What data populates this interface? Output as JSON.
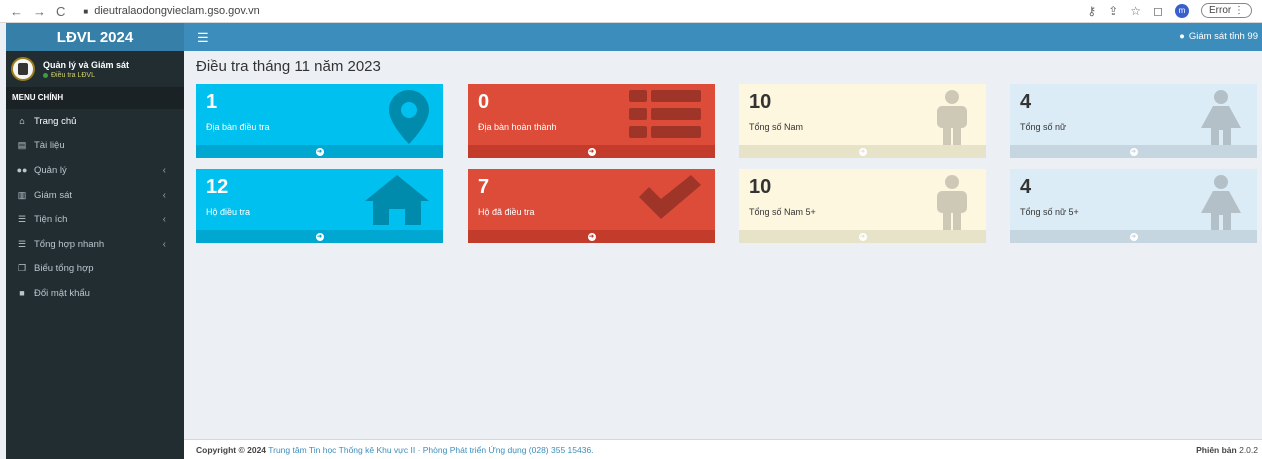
{
  "browser": {
    "back": "←",
    "forward": "→",
    "reload": "C",
    "url": "dieutralaodongvieclam.gso.gov.vn",
    "error_label": "Error"
  },
  "app": {
    "title": "LĐVL 2024"
  },
  "user_panel": {
    "name": "Quản lý và Giám sát",
    "status": "Điều tra LĐVL"
  },
  "sidebar": {
    "header": "MENU CHÍNH",
    "items": [
      {
        "label": "Trang chủ",
        "icon": "home-icon"
      },
      {
        "label": "Tài liệu",
        "icon": "document-icon"
      },
      {
        "label": "Quản lý",
        "icon": "users-icon"
      },
      {
        "label": "Giám sát",
        "icon": "chart-icon"
      },
      {
        "label": "Tiện ích",
        "icon": "list-icon"
      },
      {
        "label": "Tổng hợp nhanh",
        "icon": "list-icon"
      },
      {
        "label": "Biểu tổng hợp",
        "icon": "copy-icon"
      },
      {
        "label": "Đổi mật khẩu",
        "icon": "lock-icon"
      }
    ]
  },
  "topbar": {
    "user": "Giám sát tỉnh 99"
  },
  "page": {
    "title": "Điều tra tháng 11 năm 2023"
  },
  "boxes": [
    {
      "number": "1",
      "label": "Địa bàn điều tra",
      "color": "#00c0ef",
      "icon": "map-marker-icon"
    },
    {
      "number": "0",
      "label": "Địa bàn hoàn thành",
      "color": "#dd4b39",
      "icon": "list-icon"
    },
    {
      "number": "10",
      "label": "Tổng số Nam",
      "color": "#fdf7e0",
      "icon": "male-icon"
    },
    {
      "number": "4",
      "label": "Tổng số nữ",
      "color": "#dcecf6",
      "icon": "female-icon"
    },
    {
      "number": "12",
      "label": "Hộ điều tra",
      "color": "#00c0ef",
      "icon": "home-icon"
    },
    {
      "number": "7",
      "label": "Hộ đã điều tra",
      "color": "#dd4b39",
      "icon": "check-icon"
    },
    {
      "number": "10",
      "label": "Tổng số Nam 5+",
      "color": "#fdf7e0",
      "icon": "male-icon"
    },
    {
      "number": "4",
      "label": "Tổng số nữ 5+",
      "color": "#dcecf6",
      "icon": "female-icon"
    }
  ],
  "footer": {
    "copyright_prefix": "Copyright © 2024",
    "link_text": "Trung tâm Tin học Thống kê Khu vực II · Phòng Phát triển Ứng dụng (028) 355 15436.",
    "version_label": "Phiên bản",
    "version": "2.0.2"
  }
}
